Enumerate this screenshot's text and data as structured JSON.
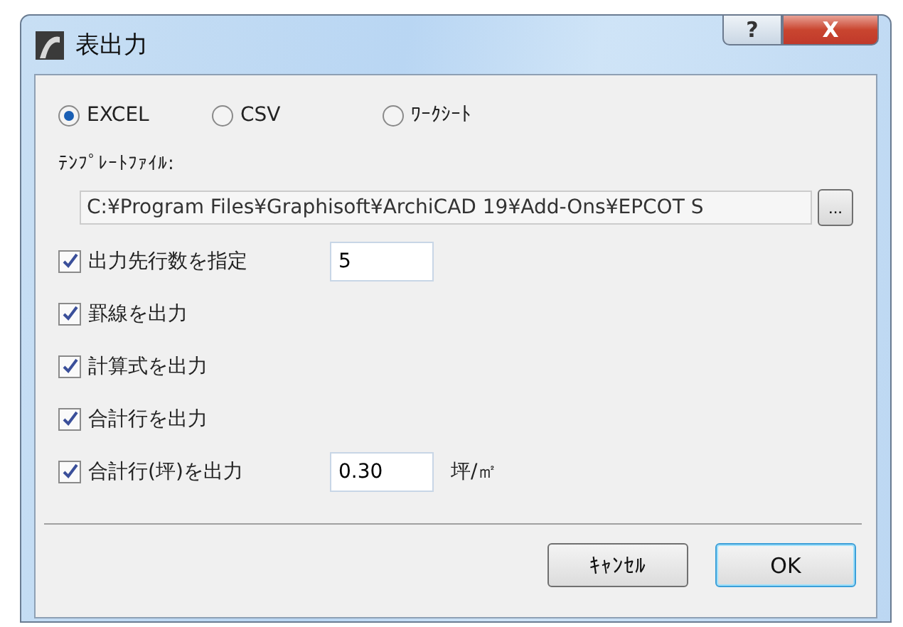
{
  "window": {
    "title": "表出力",
    "buttons": [
      "?",
      "X"
    ]
  },
  "formats": [
    {
      "label": "EXCEL",
      "selected": true
    },
    {
      "label": "CSV",
      "selected": false
    },
    {
      "label": "ﾜｰｸｼｰﾄ",
      "selected": false
    }
  ],
  "template": {
    "label": "ﾃﾝﾌﾟﾚｰﾄﾌｧｲﾙ:",
    "value": "C:¥Program Files¥Graphisoft¥ArchiCAD 19¥Add-Ons¥EPCOT S",
    "browse": "..."
  },
  "options": [
    {
      "kind": "field",
      "label": "出力先行数を指定",
      "checked": true,
      "value": "5"
    },
    {
      "kind": "plain",
      "label": "罫線を出力",
      "checked": true
    },
    {
      "kind": "plain",
      "label": "計算式を出力",
      "checked": true
    },
    {
      "kind": "plain",
      "label": "合計行を出力",
      "checked": true
    },
    {
      "kind": "field",
      "label": "合計行(坪)を出力",
      "checked": true,
      "value": "0.30",
      "unit": "坪/㎡"
    }
  ],
  "buttons": [
    {
      "label": "ｷｬﾝｾﾙ",
      "default": false
    },
    {
      "label": "OK",
      "default": true
    }
  ]
}
